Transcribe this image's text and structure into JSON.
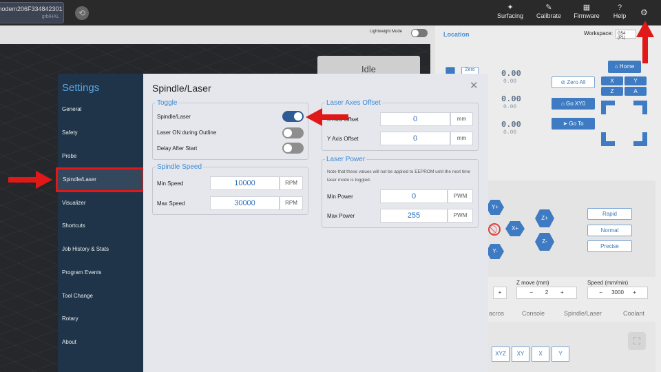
{
  "topbar": {
    "connection": {
      "port": "modem206F334842301",
      "firmware": "grblHAL"
    },
    "buttons": [
      {
        "label": "Surfacing",
        "icon": "surfacing-icon",
        "glyph": "✦"
      },
      {
        "label": "Calibrate",
        "icon": "ruler-icon",
        "glyph": "✎"
      },
      {
        "label": "Firmware",
        "icon": "chip-icon",
        "glyph": "▦"
      },
      {
        "label": "Help",
        "icon": "question-icon",
        "glyph": "?"
      }
    ],
    "settings_glyph": "⚙"
  },
  "background": {
    "lightweight_mode_label": "Lightweight Mode",
    "state": "Idle",
    "location_title": "Location",
    "workspace_label": "Workspace:",
    "workspace_value": "G54 (P1)",
    "axes": [
      {
        "big": "0.00",
        "small": "0.00"
      },
      {
        "big": "0.00",
        "small": "0.00"
      },
      {
        "big": "0.00",
        "small": "0.00"
      }
    ],
    "zero_all": "Zero All",
    "go_xy0": "Go XY0",
    "go_to": "Go To",
    "home": "Home",
    "home_axes": [
      "X",
      "Y",
      "Z",
      "A"
    ],
    "zero_tag": "Zero",
    "jog_buttons": {
      "y_plus": "Y+",
      "y_minus": "Y-",
      "x_plus": "X+",
      "z_plus": "Z+",
      "z_minus": "Z-"
    },
    "speed_buttons": [
      "Rapid",
      "Normal",
      "Precise"
    ],
    "z_move_label": "Z move (mm)",
    "z_move_value": "2",
    "speed_label": "Speed (mm/min)",
    "speed_value": "3000",
    "tabs": [
      "acros",
      "Console",
      "Spindle/Laser",
      "Coolant"
    ],
    "axis_buttons": [
      "XYZ",
      "XY",
      "X",
      "Y"
    ]
  },
  "settings": {
    "title": "Settings",
    "nav": [
      "General",
      "Safety",
      "Probe",
      "Spindle/Laser",
      "Visualizer",
      "Shortcuts",
      "Job History & Stats",
      "Program Events",
      "Tool Change",
      "Rotary",
      "About"
    ],
    "active_nav": "Spindle/Laser",
    "page_title": "Spindle/Laser",
    "toggle_group": {
      "legend": "Toggle",
      "items": [
        {
          "label": "Spindle/Laser",
          "on": true
        },
        {
          "label": "Laser ON during Outline",
          "on": false
        },
        {
          "label": "Delay After Start",
          "on": false
        }
      ]
    },
    "spindle_speed": {
      "legend": "Spindle Speed",
      "min_label": "Min Speed",
      "min_value": "10000",
      "min_unit": "RPM",
      "max_label": "Max Speed",
      "max_value": "30000",
      "max_unit": "RPM"
    },
    "laser_offset": {
      "legend": "Laser Axes Offset",
      "x_label": "X Axis Offset",
      "x_value": "0",
      "x_unit": "mm",
      "y_label": "Y Axis Offset",
      "y_value": "0",
      "y_unit": "mm"
    },
    "laser_power": {
      "legend": "Laser Power",
      "note": "Note that these values will not be applied to EEPROM until the next time laser mode is toggled.",
      "min_label": "Min Power",
      "min_value": "0",
      "min_unit": "PWM",
      "max_label": "Max Power",
      "max_value": "255",
      "max_unit": "PWM"
    },
    "close_glyph": "✕"
  },
  "colors": {
    "annotation": "#e01818",
    "accent": "#3a8ad4",
    "sidebar": "#1f3448"
  }
}
